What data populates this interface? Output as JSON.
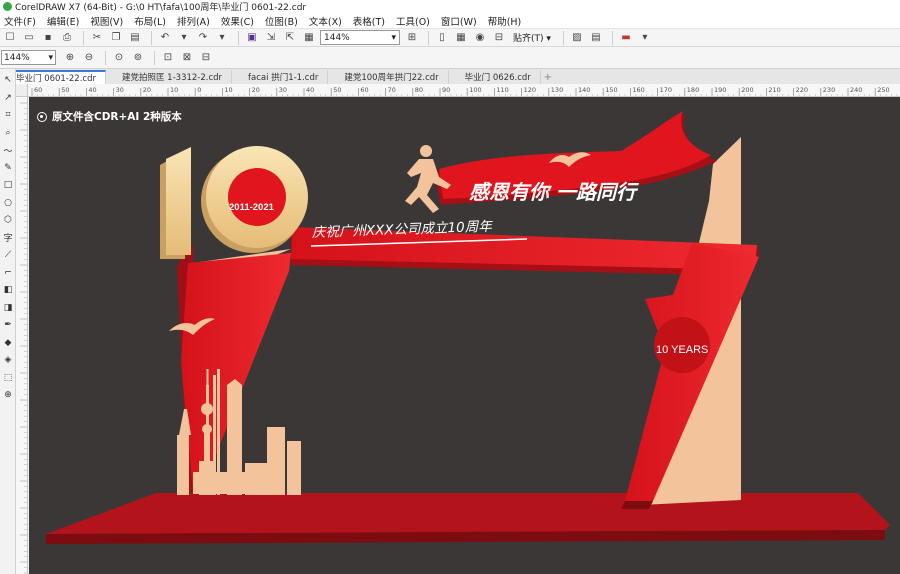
{
  "window": {
    "title": "CorelDRAW X7 (64-Bit) - G:\\0 HT\\fafa\\100周年\\毕业门 0601-22.cdr"
  },
  "menu": [
    "文件(F)",
    "编辑(E)",
    "视图(V)",
    "布局(L)",
    "排列(A)",
    "效果(C)",
    "位图(B)",
    "文本(X)",
    "表格(T)",
    "工具(O)",
    "窗口(W)",
    "帮助(H)"
  ],
  "toolbar": {
    "zoom_value": "144%",
    "snap_label": "贴齐(T)"
  },
  "propbar": {
    "zoom_value": "144%"
  },
  "tabs": [
    "毕业门 0601-22.cdr",
    "建党拍照匡 1-3312-2.cdr",
    "facai 拱门1-1.cdr",
    "建党100周年拱门22.cdr",
    "毕业门 0626.cdr"
  ],
  "ruler": {
    "h_labels": [
      "60",
      "50",
      "40",
      "30",
      "20",
      "10",
      "0",
      "10",
      "20",
      "30",
      "40",
      "50",
      "60",
      "70",
      "80",
      "90",
      "100",
      "110",
      "120",
      "130",
      "140",
      "150",
      "160",
      "170",
      "180",
      "190",
      "200",
      "210",
      "220",
      "230",
      "240",
      "250"
    ]
  },
  "artwork": {
    "badge": "原文件含CDR+AI 2种版本",
    "big_number": "10",
    "years_range": "2011-2021",
    "slogan": "感恩有你  一路同行",
    "subtitle": "庆祝广州XXX公司成立10周年",
    "ten_years": "10 YEARS"
  },
  "colors": {
    "canvas": "#3b3737",
    "red": "#e0151d",
    "dark_red": "#a50f15",
    "beige": "#f3c49b",
    "gold": "#efd08c"
  }
}
